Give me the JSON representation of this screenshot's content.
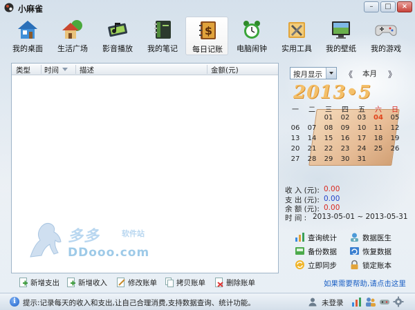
{
  "window": {
    "title": "小麻雀",
    "min_glyph": "–",
    "max_glyph": "□",
    "close_glyph": "×"
  },
  "toolbar": [
    {
      "label": "我的桌面",
      "icon": "house-icon"
    },
    {
      "label": "生活广场",
      "icon": "home-tree-icon"
    },
    {
      "label": "影音播放",
      "icon": "film-note-icon"
    },
    {
      "label": "我的笔记",
      "icon": "notebook-icon"
    },
    {
      "label": "每日记账",
      "icon": "ledger-dollar-icon",
      "active": true
    },
    {
      "label": "电脑闹钟",
      "icon": "alarm-clock-icon"
    },
    {
      "label": "实用工具",
      "icon": "toolbox-icon"
    },
    {
      "label": "我的壁纸",
      "icon": "wallpaper-icon"
    },
    {
      "label": "我的游戏",
      "icon": "gamepad-icon"
    }
  ],
  "list": {
    "columns": [
      "类型",
      "时间",
      "描述",
      "金额(元)"
    ]
  },
  "watermark": {
    "line1": "多多",
    "line2": "软件站",
    "line3": "DDooo.com"
  },
  "actions": [
    {
      "label": "新增支出",
      "icon": "add-expense-icon"
    },
    {
      "label": "新增收入",
      "icon": "add-income-icon"
    },
    {
      "label": "修改账单",
      "icon": "edit-bill-icon"
    },
    {
      "label": "拷贝账单",
      "icon": "copy-bill-icon"
    },
    {
      "label": "删除账单",
      "icon": "delete-bill-icon"
    }
  ],
  "calendar": {
    "view_select": "按月显示",
    "prev": "《",
    "current": "本月",
    "next": "》",
    "year_month": "2013•5",
    "weekdays": [
      "一",
      "二",
      "三",
      "四",
      "五",
      "六",
      "日"
    ],
    "weeks": [
      [
        "",
        "",
        "01",
        "02",
        "03",
        "04",
        "05"
      ],
      [
        "06",
        "07",
        "08",
        "09",
        "10",
        "11",
        "12"
      ],
      [
        "13",
        "14",
        "15",
        "16",
        "17",
        "18",
        "19"
      ],
      [
        "20",
        "21",
        "22",
        "23",
        "24",
        "25",
        "26"
      ],
      [
        "27",
        "28",
        "29",
        "30",
        "31",
        "",
        ""
      ]
    ],
    "today": "04"
  },
  "summary": {
    "income_label": "收 入 (元):",
    "income_value": "0.00",
    "expense_label": "支 出 (元):",
    "expense_value": "0.00",
    "balance_label": "余 额 (元):",
    "balance_value": "0.00",
    "time_label": "时 间 :",
    "time_value": "2013-05-01 ~ 2013-05-31"
  },
  "right_buttons": [
    {
      "label": "查询统计",
      "icon": "chart-icon"
    },
    {
      "label": "数据医生",
      "icon": "doctor-icon"
    },
    {
      "label": "备份数据",
      "icon": "backup-icon"
    },
    {
      "label": "恢复数据",
      "icon": "restore-icon"
    },
    {
      "label": "立即同步",
      "icon": "sync-icon"
    },
    {
      "label": "锁定账本",
      "icon": "lock-icon"
    }
  ],
  "help_link": "如果需要帮助,请点击这里",
  "status": {
    "info_glyph": "i",
    "tip": "提示:记录每天的收入和支出,让自己合理消费,支持数据查询、统计功能。",
    "login": "未登录"
  },
  "colors": {
    "accent_red": "#d8281f",
    "accent_blue": "#2343c8",
    "link_blue": "#1a5fc4"
  }
}
